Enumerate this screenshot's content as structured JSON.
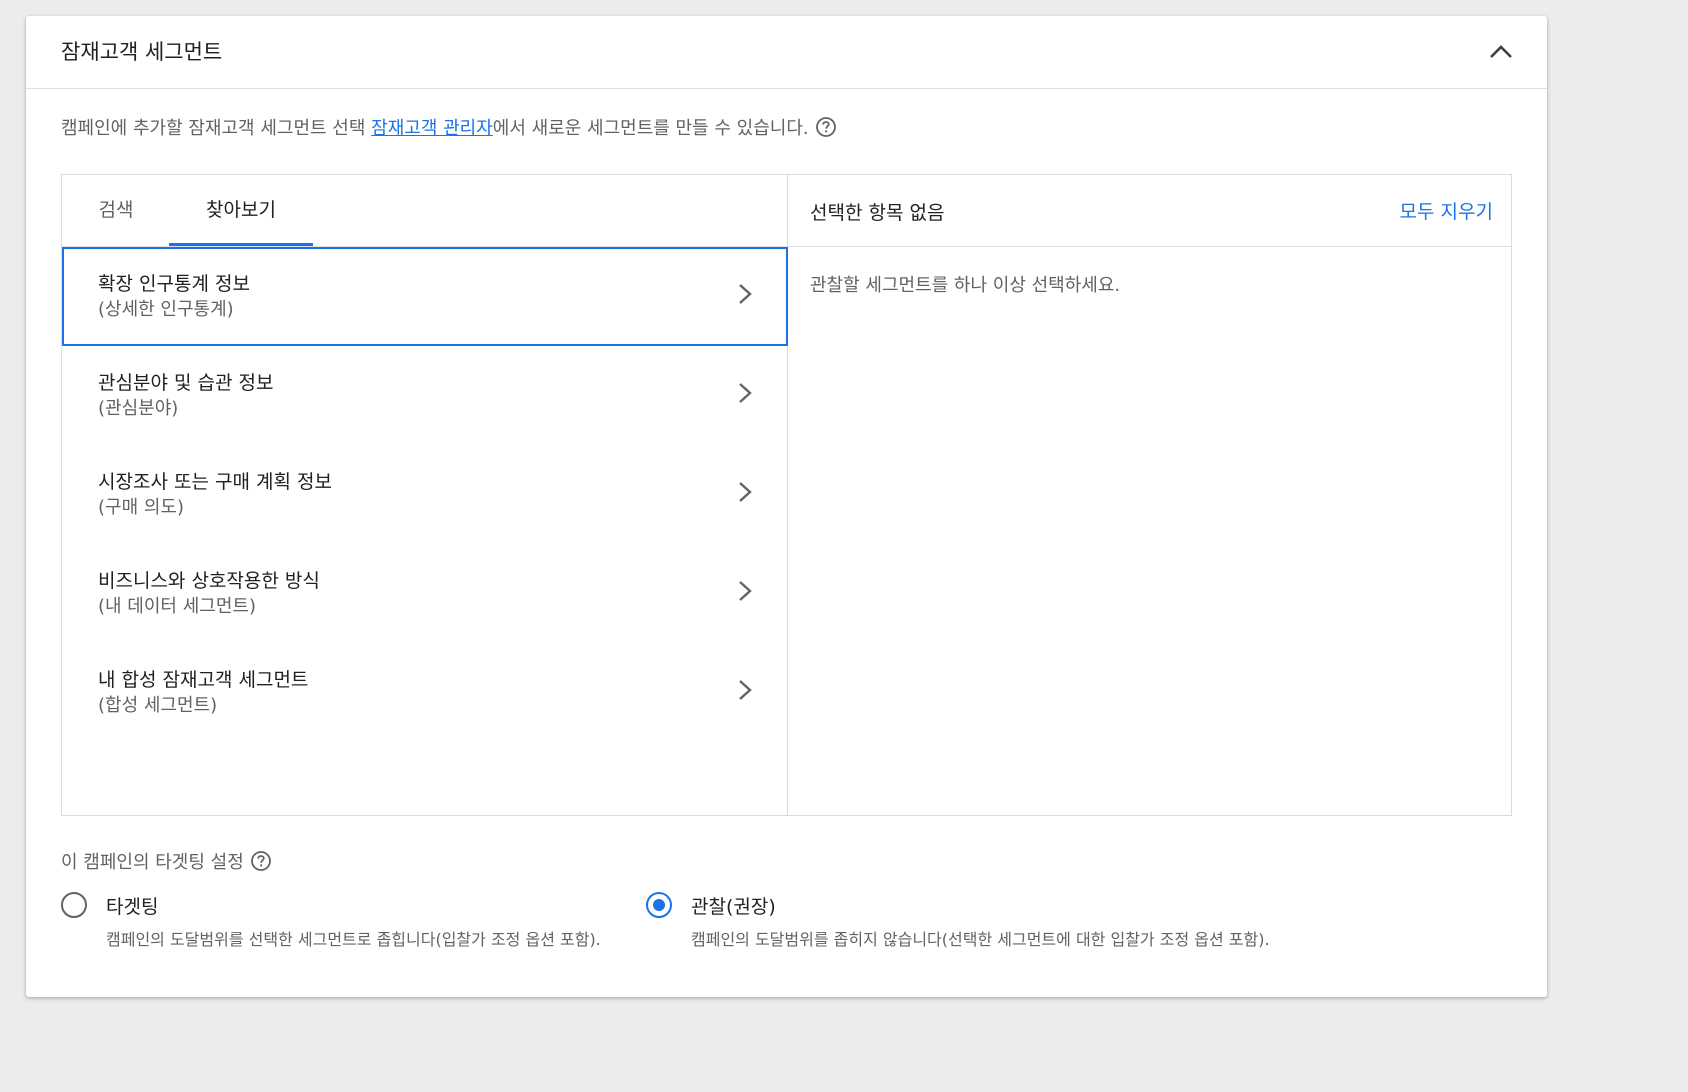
{
  "header": {
    "title": "잠재고객 세그먼트",
    "collapse_icon": "chevron-up-icon"
  },
  "description": {
    "before": "캠페인에 추가할 잠재고객 세그먼트 선택 ",
    "link": "잠재고객 관리자",
    "after": "에서 새로운 세그먼트를 만들 수 있습니다.",
    "help_icon": "help-circle-icon"
  },
  "tabs": [
    {
      "label": "검색",
      "active": false
    },
    {
      "label": "찾아보기",
      "active": true
    }
  ],
  "categories": [
    {
      "title": "확장 인구통계 정보",
      "subtitle": "(상세한 인구통계)",
      "selected": true
    },
    {
      "title": "관심분야 및 습관 정보",
      "subtitle": "(관심분야)",
      "selected": false
    },
    {
      "title": "시장조사 또는 구매 계획 정보",
      "subtitle": "(구매 의도)",
      "selected": false
    },
    {
      "title": "비즈니스와 상호작용한 방식",
      "subtitle": "(내 데이터 세그먼트)",
      "selected": false
    },
    {
      "title": "내 합성 잠재고객 세그먼트",
      "subtitle": "(합성 세그먼트)",
      "selected": false
    }
  ],
  "selection": {
    "status": "선택한 항목 없음",
    "clear_all": "모두 지우기",
    "hint": "관찰할 세그먼트를 하나 이상 선택하세요."
  },
  "targeting": {
    "label": "이 캠페인의 타겟팅 설정",
    "options": [
      {
        "title": "타겟팅",
        "description": "캠페인의 도달범위를 선택한 세그먼트로 좁힙니다(입찰가 조정 옵션 포함).",
        "checked": false
      },
      {
        "title": "관찰(권장)",
        "description": "캠페인의 도달범위를 좁히지 않습니다(선택한 세그먼트에 대한 입찰가 조정 옵션 포함).",
        "checked": true
      }
    ]
  },
  "colors": {
    "accent": "#1a73e8",
    "text_primary": "#202124",
    "text_secondary": "#5f6368",
    "border": "#dadce0"
  }
}
